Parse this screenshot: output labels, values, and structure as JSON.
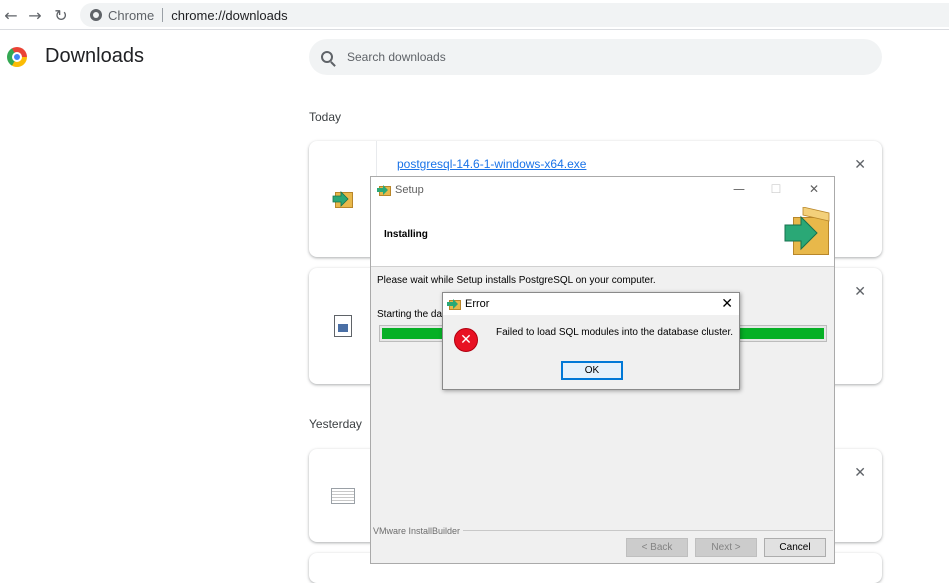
{
  "browser": {
    "chip_label": "Chrome",
    "url": "chrome://downloads"
  },
  "downloads": {
    "title": "Downloads",
    "search_placeholder": "Search downloads",
    "sections": [
      {
        "label": "Today"
      },
      {
        "label": "Yesterday"
      }
    ],
    "items": [
      {
        "filename": "postgresql-14.6-1-windows-x64.exe"
      }
    ]
  },
  "setup": {
    "title": "Setup",
    "heading": "Installing",
    "message": "Please wait while Setup installs PostgreSQL on your computer.",
    "status": "Starting the dat",
    "progress": 1.0,
    "footer_brand": "VMware InstallBuilder",
    "buttons": {
      "back": "< Back",
      "next": "Next >",
      "cancel": "Cancel"
    }
  },
  "error": {
    "title": "Error",
    "message": "Failed to load SQL modules into the database cluster.",
    "ok_label": "OK"
  },
  "colors": {
    "link": "#1a73e8",
    "progress": "#06b025",
    "error": "#e81123"
  }
}
